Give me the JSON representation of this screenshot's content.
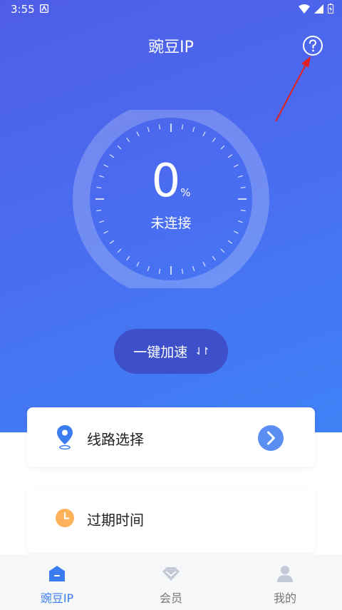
{
  "status_bar": {
    "time": "3:55"
  },
  "header": {
    "title": "豌豆IP"
  },
  "gauge": {
    "value": "0",
    "unit": "%",
    "status": "未连接"
  },
  "boost_button": {
    "label": "一键加速",
    "arrows": "⇃↾"
  },
  "route_card": {
    "label": "线路选择"
  },
  "expire_card": {
    "label": "过期时间"
  },
  "tabs": [
    {
      "label": "豌豆IP",
      "icon": "home-icon",
      "active": true
    },
    {
      "label": "会员",
      "icon": "diamond-icon",
      "active": false
    },
    {
      "label": "我的",
      "icon": "user-icon",
      "active": false
    }
  ],
  "colors": {
    "hero_start": "#4f5de6",
    "hero_end": "#3f82f6",
    "boost_bg": "#3d4fc9",
    "accent_blue": "#3b7df0",
    "clock_orange": "#fdb15a",
    "annotation_red": "#e0201e"
  }
}
